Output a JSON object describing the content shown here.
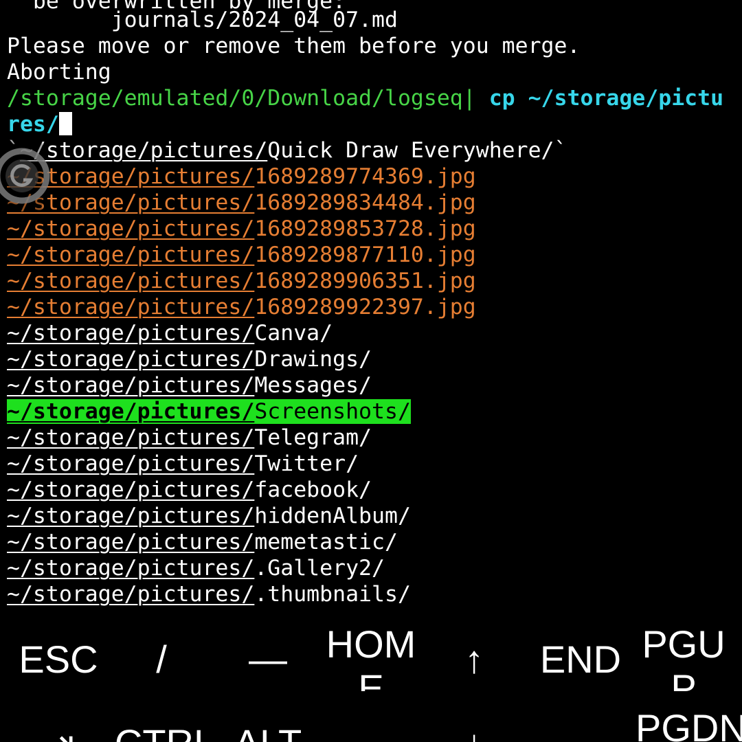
{
  "terminal": {
    "top_line": "  be overwritten by merge:",
    "conflict_file": "        journals/2024_04_07.md",
    "message": "Please move or remove them before you merge.",
    "aborting": "Aborting",
    "prompt": {
      "cwd": "/storage/emulated/0/Download/logseq",
      "separator": "|",
      "command_part1": " cp ~/storage/pictu",
      "command_part2": "res/"
    },
    "completion_prefix": "~/storage/pictures/",
    "first_entry": {
      "lead": "`",
      "name": "Quick Draw Everywhere/`"
    },
    "image_files": [
      "1689289774369.jpg",
      "1689289834484.jpg",
      "1689289853728.jpg",
      "1689289877110.jpg",
      "1689289906351.jpg",
      "1689289922397.jpg"
    ],
    "directories_before_selection": [
      "Canva/",
      "Drawings/",
      "Messages/"
    ],
    "selected_directory": "Screenshots/",
    "directories_after_selection": [
      "Telegram/",
      "Twitter/",
      "facebook/",
      "hiddenAlbum/",
      "memetastic/",
      ".Gallery2/",
      ".thumbnails/"
    ]
  },
  "extra_keys": {
    "row1": [
      "ESC",
      "/",
      "—",
      "HOME",
      "↑",
      "END",
      "PGUP"
    ],
    "row2": [
      "⇥",
      "CTRL",
      "ALT",
      "←",
      "↓",
      "→",
      "PGDN"
    ]
  },
  "overlay": {
    "icon": "floating-assistant-icon",
    "color": "#7a7a7a"
  },
  "colors": {
    "background": "#000000",
    "prompt_path": "#47d447",
    "command": "#37d6ea",
    "image_file": "#e67e33",
    "selection": "#1ee01e"
  }
}
